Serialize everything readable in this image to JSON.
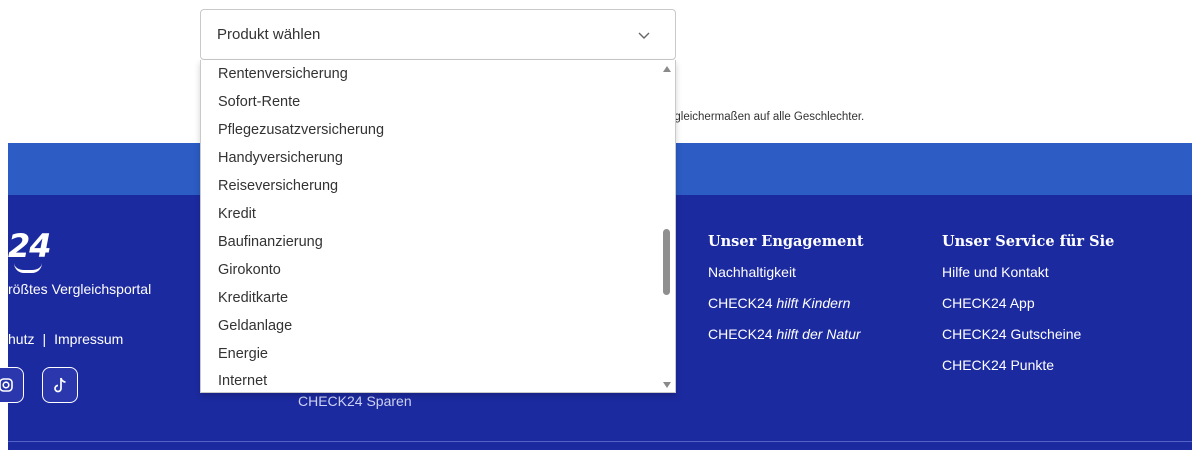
{
  "page": {
    "notice": "t gleichermaßen auf alle Geschlechter."
  },
  "select": {
    "value": "Produkt wählen",
    "options": [
      "Rentenversicherung",
      "Sofort-Rente",
      "Pflegezusatzversicherung",
      "Handyversicherung",
      "Reiseversicherung",
      "Kredit",
      "Baufinanzierung",
      "Girokonto",
      "Kreditkarte",
      "Geldanlage",
      "Energie",
      "Internet"
    ]
  },
  "footer": {
    "logo": "24",
    "tagline": "rößtes Vergleichsportal",
    "legal": {
      "link_1": "hutz",
      "separator": "|",
      "link_2": "Impressum"
    },
    "hidden_link": "CHECK24 Sparen",
    "engagement": {
      "title": "Unser Engagement",
      "links": [
        "Nachhaltigkeit",
        "hilft Kindern",
        "hilft der Natur"
      ],
      "prefix": "CHECK24"
    },
    "service": {
      "title": "Unser Service für Sie",
      "links": [
        "Hilfe und Kontakt",
        "CHECK24 App",
        "CHECK24 Gutscheine",
        "CHECK24 Punkte"
      ]
    },
    "social_icons": [
      "instagram-icon",
      "tiktok-icon"
    ]
  },
  "colors": {
    "band_blue": "#2c5cc4",
    "footer_navy": "#1c2aa0"
  }
}
